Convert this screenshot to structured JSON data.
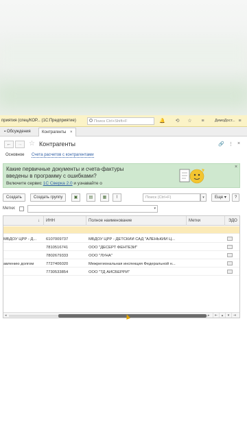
{
  "window": {
    "title": "приятия (спец/КОР...  (1С:Предприятие)",
    "search_placeholder": "Поиск Ctrl+Shift+F",
    "user": "ДемоДост..."
  },
  "tabs": [
    {
      "label": "Обсуждения"
    },
    {
      "label": "Контрагенты",
      "close": "×"
    }
  ],
  "form": {
    "title": "Контрагенты",
    "subtabs": {
      "main": "Основное",
      "link": "Счета расчетов с контрагентами"
    }
  },
  "banner": {
    "line1": "Какие первичные документы и счета-фактуры",
    "line2": "введены в программу с ошибками?",
    "line3_prefix": "Включите сервис ",
    "line3_link": "1С Сверка 2.0",
    "line3_suffix": " и узнавайте о",
    "close": "×"
  },
  "toolbar": {
    "create": "Создать",
    "create_group": "Создать группу",
    "search_placeholder": "Поиск (Ctrl+F)",
    "more": "Еще",
    "help": "?"
  },
  "tags": {
    "label": "Метки:"
  },
  "grid": {
    "columns": {
      "sort": "↓",
      "inn": "ИНН",
      "full_name": "Полное наименование",
      "tags": "Метки",
      "edo": "ЭДО"
    },
    "rows": [
      {
        "name": "",
        "inn": "",
        "full_name": ""
      },
      {
        "name": "МБДОУ ЦРР - Д...",
        "inn": "6107009737",
        "full_name": "МБДОУ ЦРР - ДЕТСКИЙ САД \"АЛЕНЬКИЙ Ц..."
      },
      {
        "name": "",
        "inn": "7810516741",
        "full_name": "ООО \"ДЕСЕРТ ФЕНТЕЗИ\""
      },
      {
        "name": "",
        "inn": "7802679333",
        "full_name": "ООО \"ЛУНА\""
      },
      {
        "name": "авлению долгом",
        "inn": "7727406020",
        "full_name": "Межрегиональная инспекция Федеральной н..."
      },
      {
        "name": "",
        "inn": "7730533854",
        "full_name": "ООО \"ТД АЙСБЕРРИ\""
      }
    ]
  },
  "colors": {
    "titlebar": "#fbf3c7",
    "banner": "#cfe8cf",
    "selected_row": "#fbeab8",
    "link": "#2f5fa5"
  }
}
